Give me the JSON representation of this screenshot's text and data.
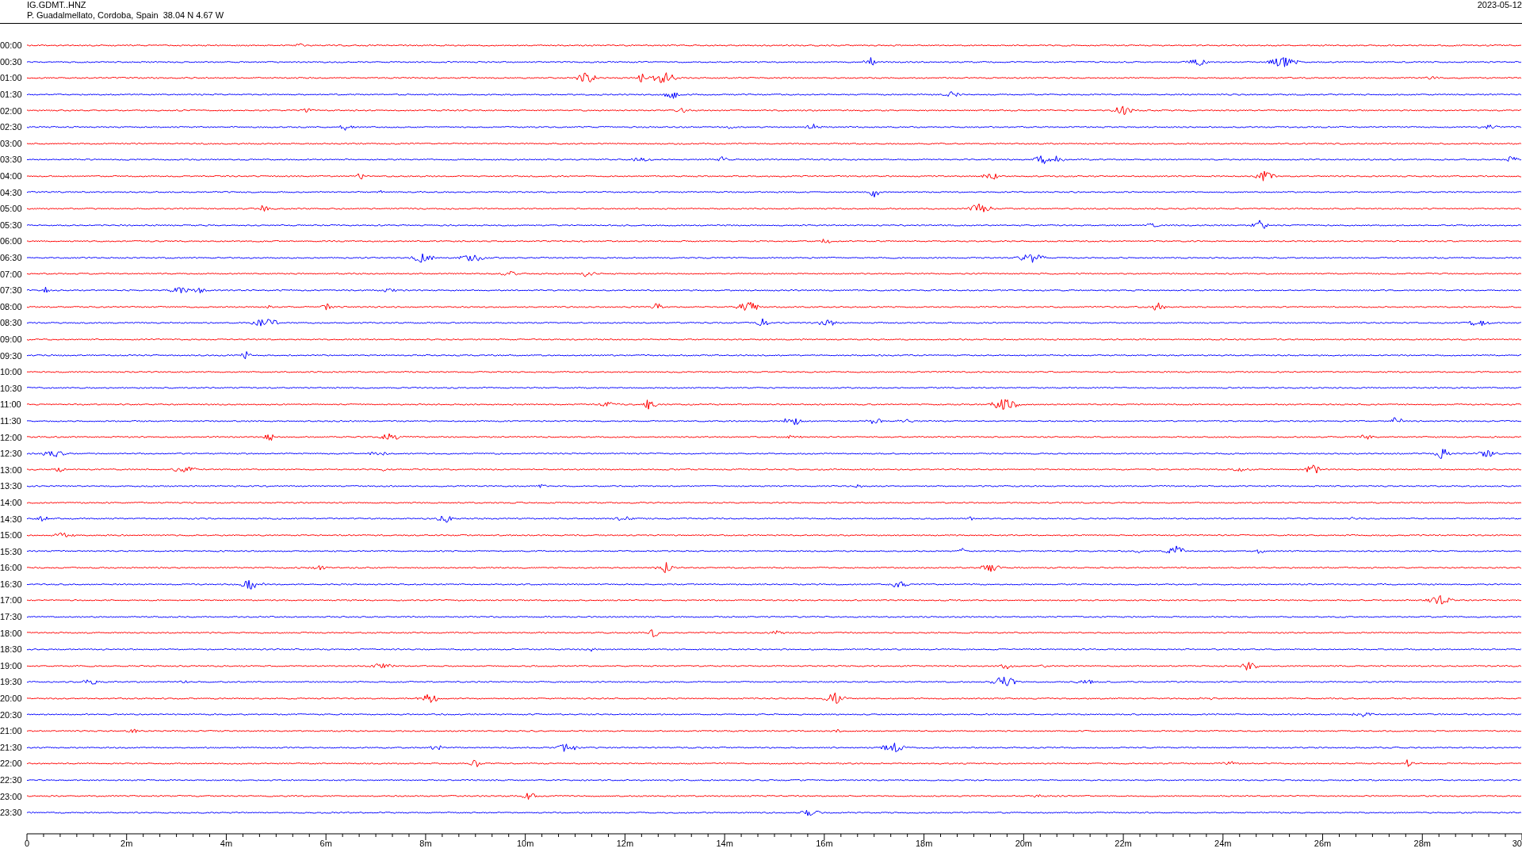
{
  "header": {
    "station": "IG.GDMT..HNZ",
    "location": "P. Guadalmellato, Cordoba, Spain  38.04 N 4.67 W",
    "date": "2023-05-12"
  },
  "traces": [
    {
      "label": "00:00",
      "color": "#ff0000"
    },
    {
      "label": "00:30",
      "color": "#0000ff"
    },
    {
      "label": "01:00",
      "color": "#ff0000"
    },
    {
      "label": "01:30",
      "color": "#0000ff"
    },
    {
      "label": "02:00",
      "color": "#ff0000"
    },
    {
      "label": "02:30",
      "color": "#0000ff"
    },
    {
      "label": "03:00",
      "color": "#ff0000"
    },
    {
      "label": "03:30",
      "color": "#0000ff"
    },
    {
      "label": "04:00",
      "color": "#ff0000"
    },
    {
      "label": "04:30",
      "color": "#0000ff"
    },
    {
      "label": "05:00",
      "color": "#ff0000"
    },
    {
      "label": "05:30",
      "color": "#0000ff"
    },
    {
      "label": "06:00",
      "color": "#ff0000"
    },
    {
      "label": "06:30",
      "color": "#0000ff"
    },
    {
      "label": "07:00",
      "color": "#ff0000"
    },
    {
      "label": "07:30",
      "color": "#0000ff"
    },
    {
      "label": "08:00",
      "color": "#ff0000"
    },
    {
      "label": "08:30",
      "color": "#0000ff"
    },
    {
      "label": "09:00",
      "color": "#ff0000"
    },
    {
      "label": "09:30",
      "color": "#0000ff"
    },
    {
      "label": "10:00",
      "color": "#ff0000"
    },
    {
      "label": "10:30",
      "color": "#0000ff"
    },
    {
      "label": "11:00",
      "color": "#ff0000"
    },
    {
      "label": "11:30",
      "color": "#0000ff"
    },
    {
      "label": "12:00",
      "color": "#ff0000"
    },
    {
      "label": "12:30",
      "color": "#0000ff"
    },
    {
      "label": "13:00",
      "color": "#ff0000"
    },
    {
      "label": "13:30",
      "color": "#0000ff"
    },
    {
      "label": "14:00",
      "color": "#ff0000"
    },
    {
      "label": "14:30",
      "color": "#0000ff"
    },
    {
      "label": "15:00",
      "color": "#ff0000"
    },
    {
      "label": "15:30",
      "color": "#0000ff"
    },
    {
      "label": "16:00",
      "color": "#ff0000"
    },
    {
      "label": "16:30",
      "color": "#0000ff"
    },
    {
      "label": "17:00",
      "color": "#ff0000"
    },
    {
      "label": "17:30",
      "color": "#0000ff"
    },
    {
      "label": "18:00",
      "color": "#ff0000"
    },
    {
      "label": "18:30",
      "color": "#0000ff"
    },
    {
      "label": "19:00",
      "color": "#ff0000"
    },
    {
      "label": "19:30",
      "color": "#0000ff"
    },
    {
      "label": "20:00",
      "color": "#ff0000"
    },
    {
      "label": "20:30",
      "color": "#0000ff"
    },
    {
      "label": "21:00",
      "color": "#ff0000"
    },
    {
      "label": "21:30",
      "color": "#0000ff"
    },
    {
      "label": "22:00",
      "color": "#ff0000"
    },
    {
      "label": "22:30",
      "color": "#0000ff"
    },
    {
      "label": "23:00",
      "color": "#ff0000"
    },
    {
      "label": "23:30",
      "color": "#0000ff"
    }
  ],
  "time_axis": {
    "labels": [
      "0",
      "2m",
      "4m",
      "6m",
      "8m",
      "10m",
      "12m",
      "14m",
      "16m",
      "18m",
      "20m",
      "22m",
      "24m",
      "26m",
      "28m",
      "30"
    ]
  }
}
